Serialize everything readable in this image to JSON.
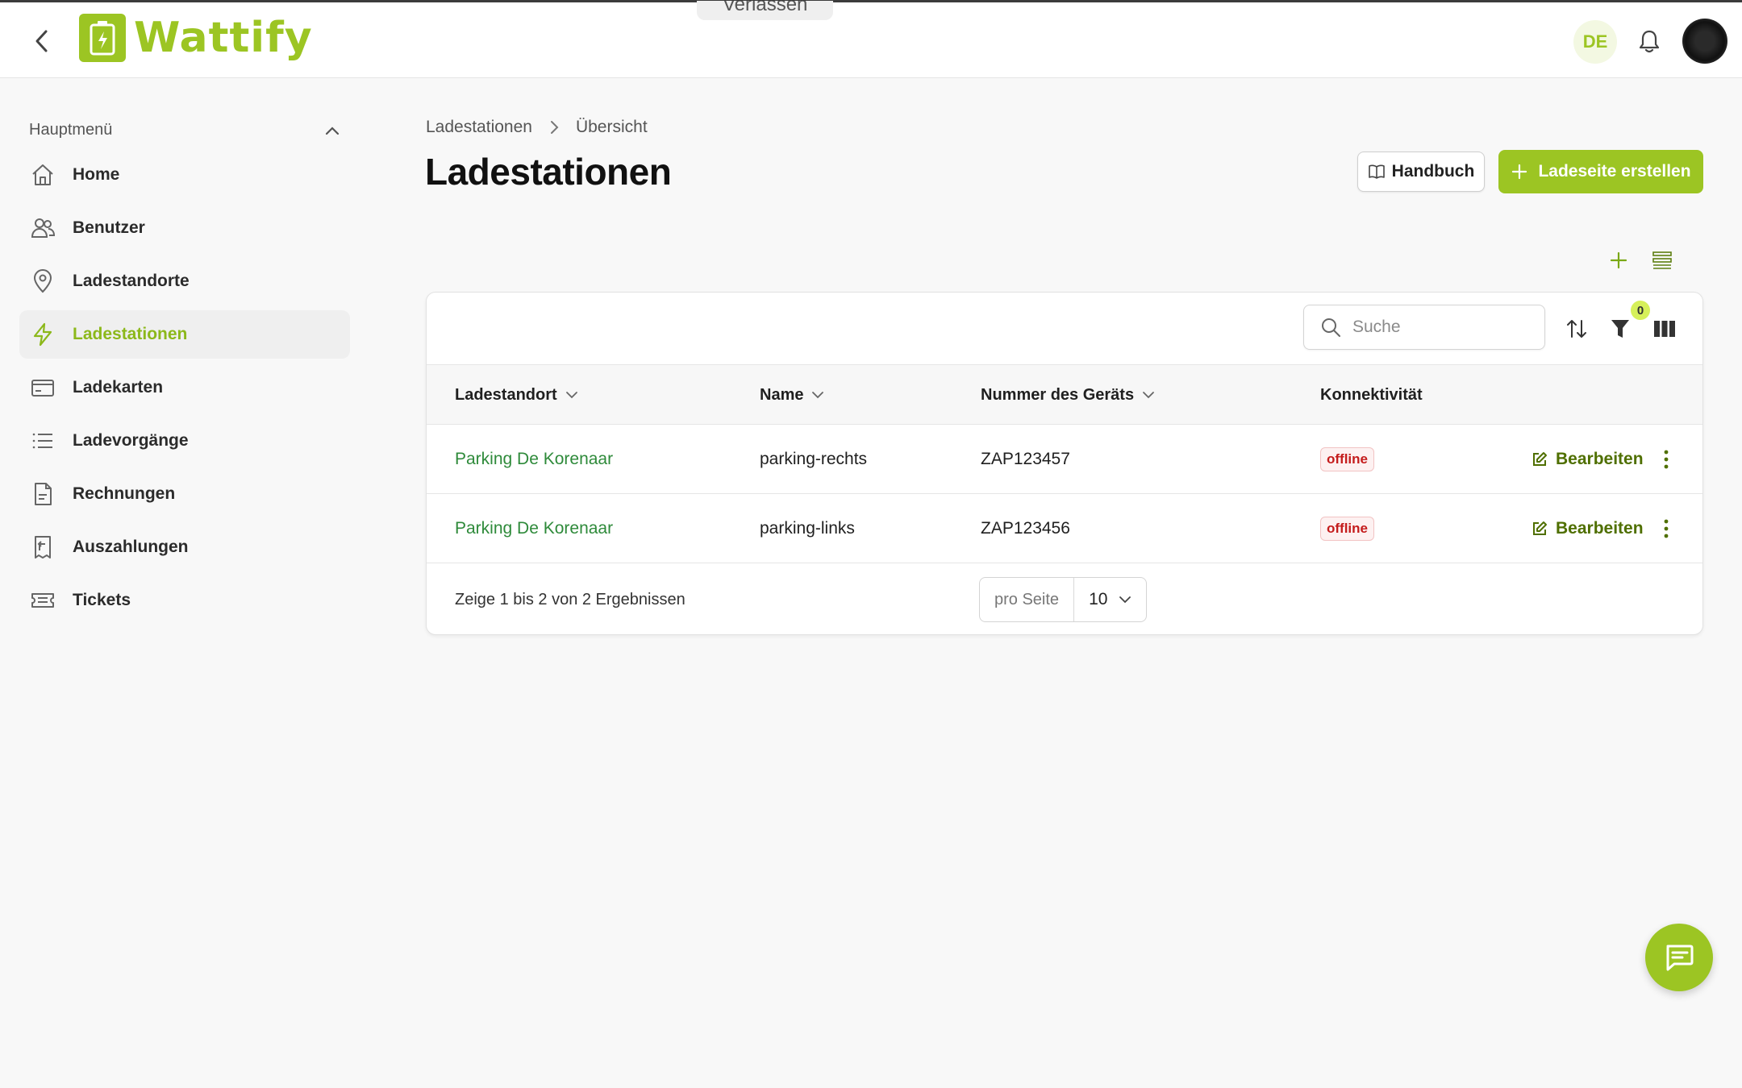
{
  "topbar": {
    "brand": "Wattify",
    "impersonation_text": "",
    "leave_label": "Verlassen",
    "language": "DE"
  },
  "sidebar": {
    "heading": "Hauptmenü",
    "items": [
      {
        "label": "Home",
        "icon": "home-icon"
      },
      {
        "label": "Benutzer",
        "icon": "users-icon"
      },
      {
        "label": "Ladestandorte",
        "icon": "map-pin-icon"
      },
      {
        "label": "Ladestationen",
        "icon": "lightning-icon",
        "active": true
      },
      {
        "label": "Ladekarten",
        "icon": "card-icon"
      },
      {
        "label": "Ladevorgänge",
        "icon": "list-icon"
      },
      {
        "label": "Rechnungen",
        "icon": "document-icon"
      },
      {
        "label": "Auszahlungen",
        "icon": "receipt-icon"
      },
      {
        "label": "Tickets",
        "icon": "ticket-icon"
      }
    ]
  },
  "breadcrumb": {
    "items": [
      "Ladestationen",
      "Übersicht"
    ]
  },
  "page": {
    "title": "Ladestationen",
    "manual_label": "Handbuch",
    "create_label": "Ladeseite erstellen"
  },
  "table": {
    "search_placeholder": "Suche",
    "filter_count": "0",
    "columns": [
      "Ladestandort",
      "Name",
      "Nummer des Geräts",
      "Konnektivität"
    ],
    "rows": [
      {
        "location": "Parking De Korenaar",
        "name": "parking-rechts",
        "device": "ZAP123457",
        "status": "offline",
        "action": "Bearbeiten"
      },
      {
        "location": "Parking De Korenaar",
        "name": "parking-links",
        "device": "ZAP123456",
        "status": "offline",
        "action": "Bearbeiten"
      }
    ],
    "summary": "Zeige 1 bis 2 von 2 Ergebnissen",
    "per_page_label": "pro Seite",
    "per_page_value": "10"
  },
  "colors": {
    "accent": "#9cc523",
    "link": "#2e8a3a",
    "danger": "#c41c1c"
  }
}
